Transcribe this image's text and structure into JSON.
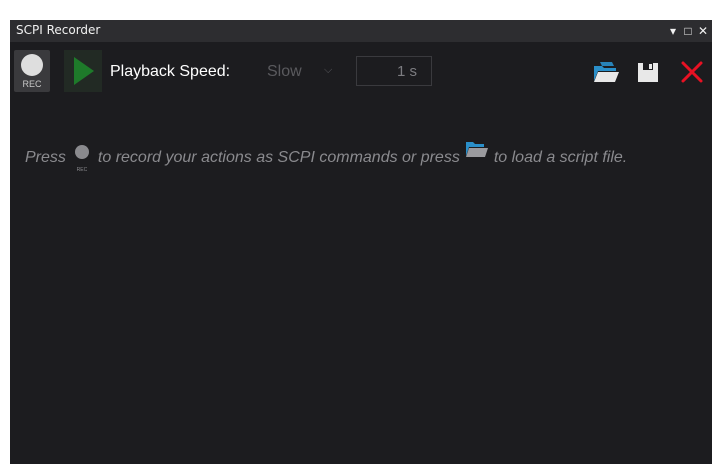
{
  "window": {
    "title": "SCPI Recorder",
    "controls": {
      "dropdown_glyph": "▾",
      "maximize_glyph": "□",
      "close_glyph": "✕"
    }
  },
  "toolbar": {
    "record_label": "REC",
    "play_icon": "play-icon",
    "playback_speed_label": "Playback Speed:",
    "speed_value": "Slow",
    "speed_chevron": "⌵",
    "interval_value": "1 s",
    "open_icon": "folder-open-icon",
    "save_icon": "save-icon",
    "clear_icon": "close-icon"
  },
  "content": {
    "hint_part1": "Press",
    "hint_rec_label": "REC",
    "hint_part2": "to record your actions as SCPI commands  or press",
    "hint_part3": "to load a script file."
  },
  "colors": {
    "accent_green": "#1e7a2a",
    "folder_blue": "#2a8fc9",
    "close_red": "#e81123",
    "background": "#1c1c1f",
    "titlebar": "#2d2d30"
  }
}
